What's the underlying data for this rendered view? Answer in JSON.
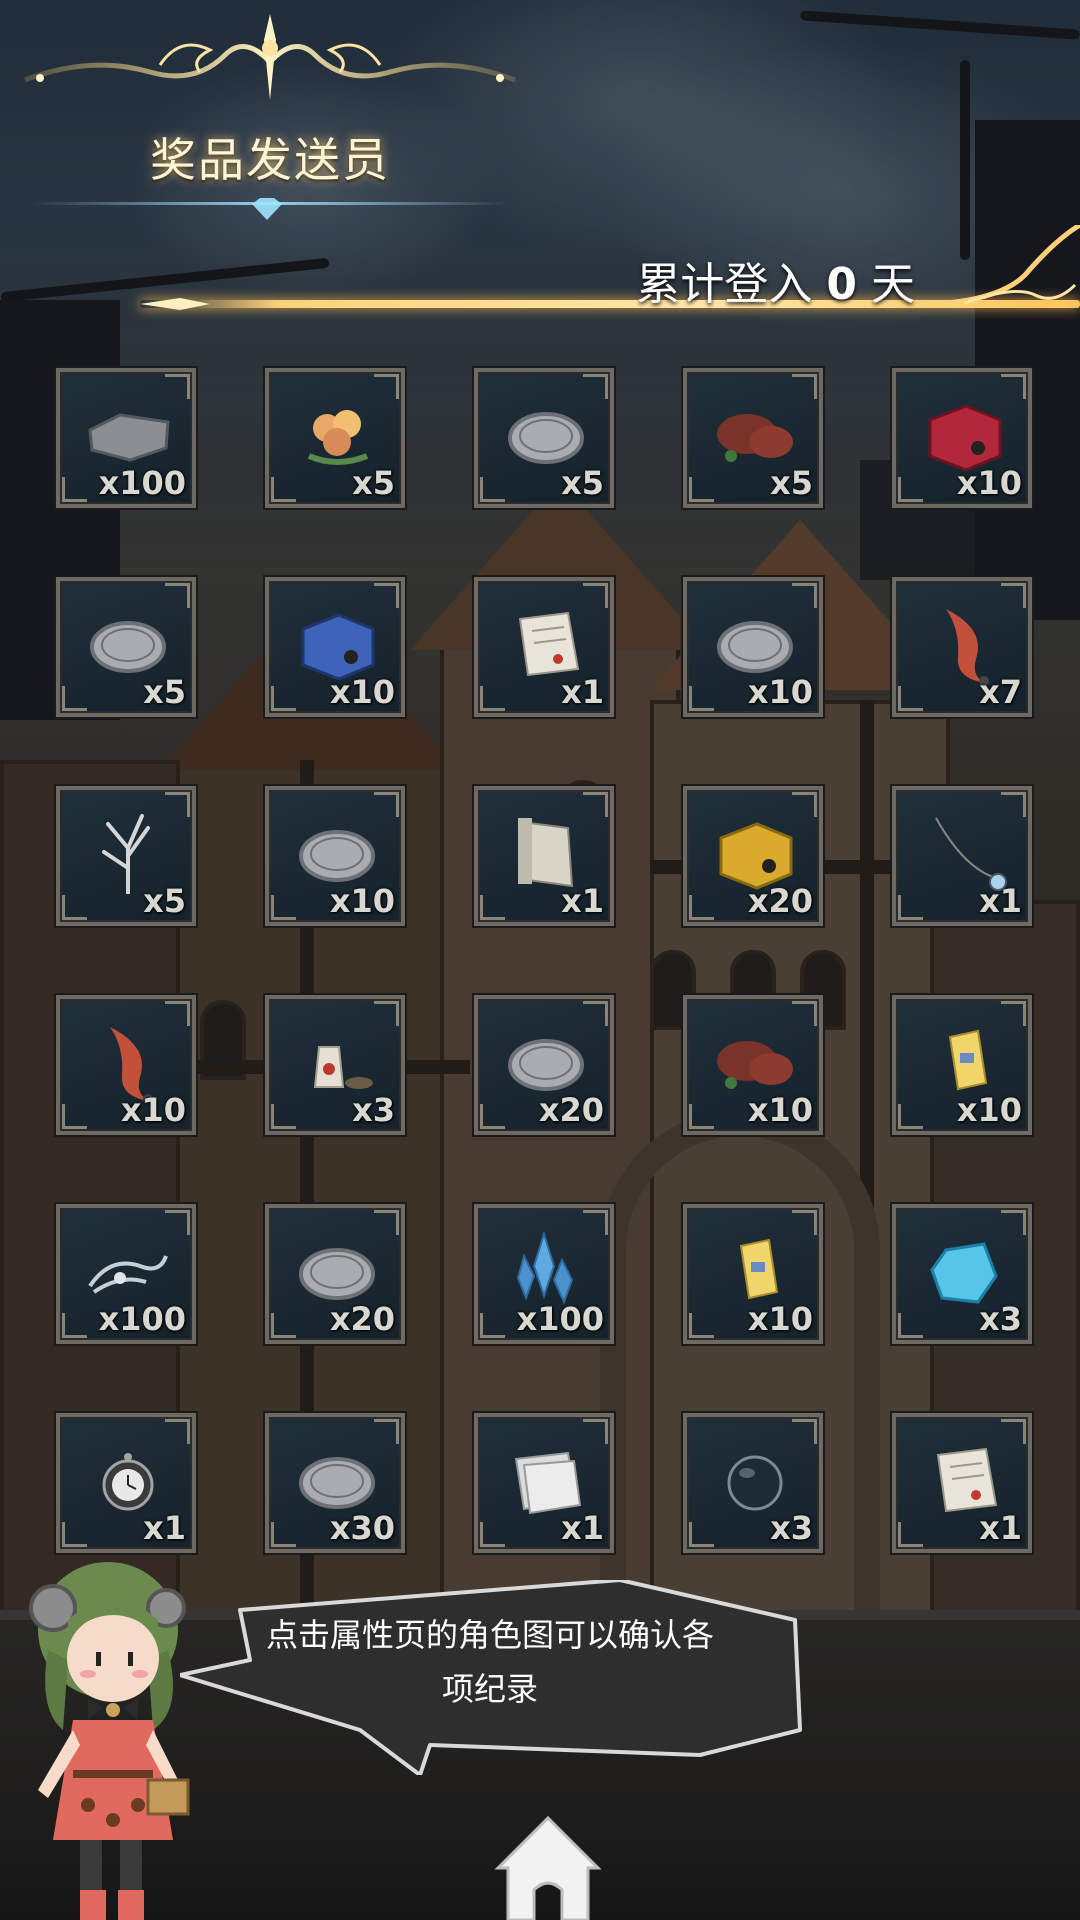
{
  "header": {
    "title": "奖品发送员",
    "login_prefix": "累计登入",
    "login_days": "0",
    "login_suffix": "天"
  },
  "rewards": [
    {
      "icon": "grey-stone-icon",
      "qty": "x100"
    },
    {
      "icon": "flower-bouquet-icon",
      "qty": "x5"
    },
    {
      "icon": "silver-coin-icon",
      "qty": "x5"
    },
    {
      "icon": "meat-icon",
      "qty": "x5"
    },
    {
      "icon": "red-box-icon",
      "qty": "x10"
    },
    {
      "icon": "silver-coin-icon",
      "qty": "x5"
    },
    {
      "icon": "blue-box-icon",
      "qty": "x10"
    },
    {
      "icon": "paper-scroll-icon",
      "qty": "x1"
    },
    {
      "icon": "silver-coin-icon",
      "qty": "x10"
    },
    {
      "icon": "red-feather-icon",
      "qty": "x7"
    },
    {
      "icon": "white-branch-icon",
      "qty": "x5"
    },
    {
      "icon": "silver-coin-icon",
      "qty": "x10"
    },
    {
      "icon": "old-scroll-icon",
      "qty": "x1"
    },
    {
      "icon": "yellow-box-icon",
      "qty": "x20"
    },
    {
      "icon": "pendant-necklace-icon",
      "qty": "x1"
    },
    {
      "icon": "red-feather-icon",
      "qty": "x10"
    },
    {
      "icon": "potion-bowl-icon",
      "qty": "x3"
    },
    {
      "icon": "silver-coin-icon",
      "qty": "x20"
    },
    {
      "icon": "meat-icon",
      "qty": "x10"
    },
    {
      "icon": "yellow-ticket-icon",
      "qty": "x10"
    },
    {
      "icon": "silver-ribbon-icon",
      "qty": "x100"
    },
    {
      "icon": "silver-coin-icon",
      "qty": "x20"
    },
    {
      "icon": "blue-crystal-icon",
      "qty": "x100"
    },
    {
      "icon": "yellow-ticket-icon",
      "qty": "x10"
    },
    {
      "icon": "blue-gem-icon",
      "qty": "x3"
    },
    {
      "icon": "pocket-watch-icon",
      "qty": "x1"
    },
    {
      "icon": "silver-coin-icon",
      "qty": "x30"
    },
    {
      "icon": "paper-stack-icon",
      "qty": "x1"
    },
    {
      "icon": "dark-orb-icon",
      "qty": "x3"
    },
    {
      "icon": "paper-scroll-icon",
      "qty": "x1"
    }
  ],
  "npc": {
    "dialog": "点击属性页的角色图可以确认各项纪录"
  },
  "nav": {
    "home_icon": "home-icon"
  },
  "colors": {
    "accent_gold": "#ffd27a",
    "slot_bg": "#1a2933",
    "slot_border": "#6c6a63"
  }
}
